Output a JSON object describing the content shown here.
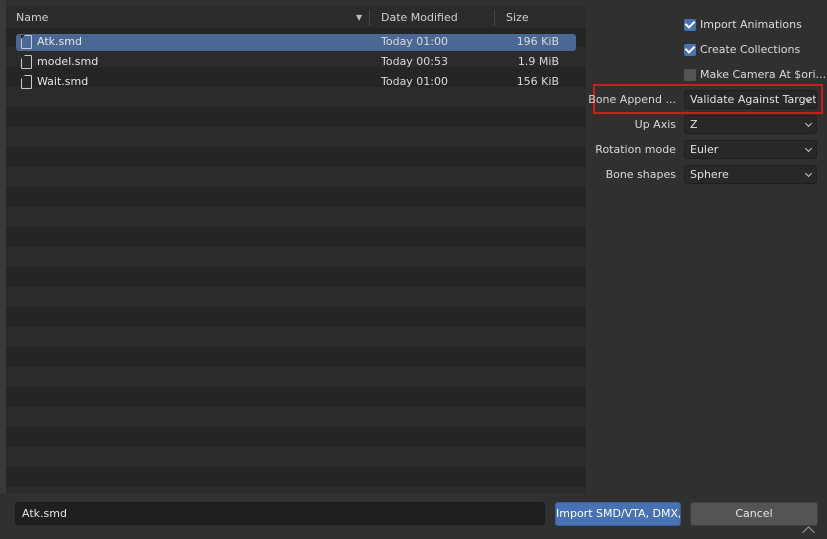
{
  "columns": {
    "name": "Name",
    "date": "Date Modified",
    "size": "Size"
  },
  "files": [
    {
      "name": "Atk.smd",
      "date": "Today 01:00",
      "size": "196 KiB",
      "selected": true
    },
    {
      "name": "model.smd",
      "date": "Today 00:53",
      "size": "1.9 MiB",
      "selected": false
    },
    {
      "name": "Wait.smd",
      "date": "Today 01:00",
      "size": "156 KiB",
      "selected": false
    }
  ],
  "options": {
    "import_animations": {
      "label": "Import Animations",
      "checked": true
    },
    "create_collections": {
      "label": "Create Collections",
      "checked": true
    },
    "make_camera": {
      "label": "Make Camera At $ori...",
      "checked": false
    },
    "bone_append": {
      "label": "Bone Append ...",
      "value": "Validate Against Target"
    },
    "up_axis": {
      "label": "Up Axis",
      "value": "Z"
    },
    "rotation_mode": {
      "label": "Rotation mode",
      "value": "Euler"
    },
    "bone_shapes": {
      "label": "Bone shapes",
      "value": "Sphere"
    }
  },
  "footer": {
    "filename": "Atk.smd",
    "import_label": "Import SMD/VTA, DMX,...",
    "cancel_label": "Cancel"
  },
  "colors": {
    "accent": "#4772b3",
    "selection": "#4a6893",
    "highlight": "#d11a1a"
  }
}
